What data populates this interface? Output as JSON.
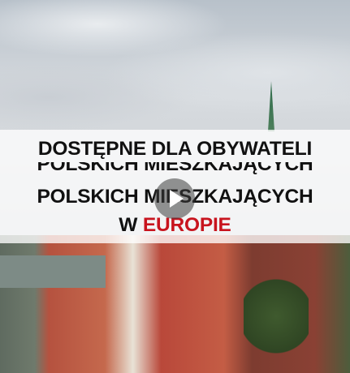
{
  "overlay": {
    "line1": "DOSTĘPNE DLA OBYWATELI",
    "line2": "POLSKICH MIESZKAJĄCYCH",
    "line3_prefix": "W",
    "line3_highlight": "EUROPIE"
  },
  "colors": {
    "highlight": "#c8141e"
  },
  "icons": {
    "play": "play-icon"
  }
}
